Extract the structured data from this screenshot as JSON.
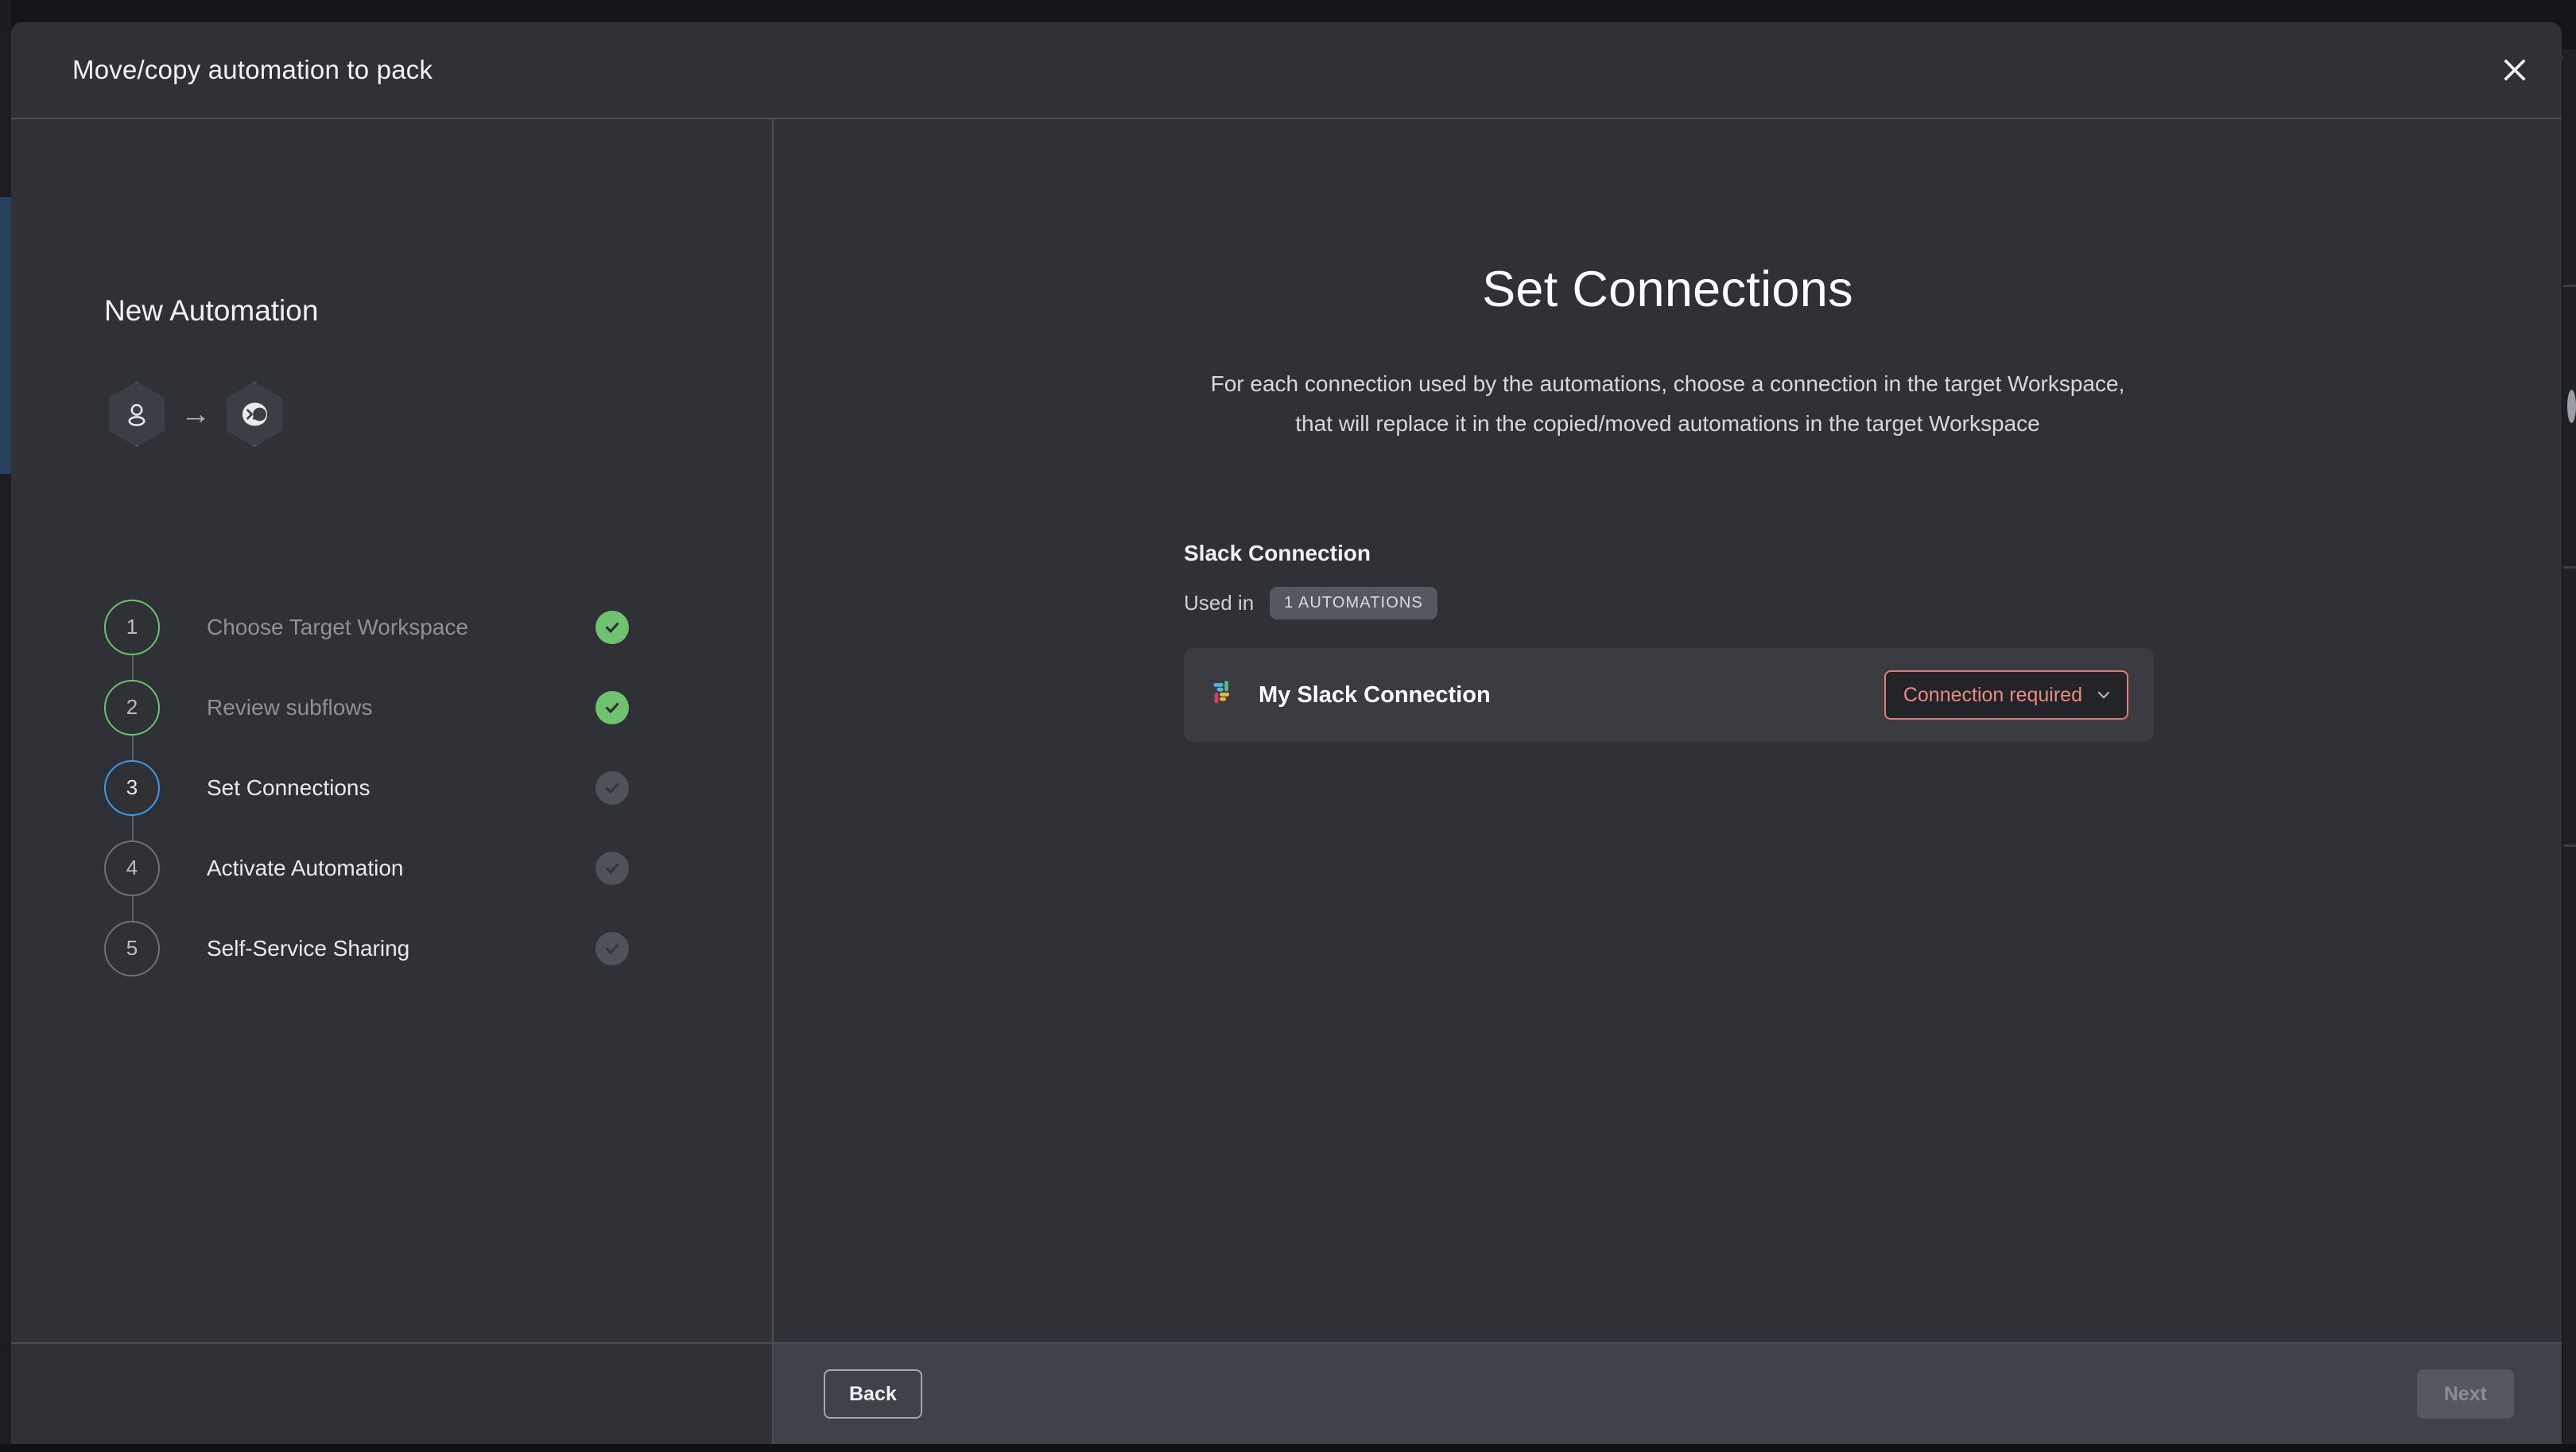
{
  "modal": {
    "title": "Move/copy automation to pack",
    "close_icon": "close-icon"
  },
  "sidebar": {
    "heading": "New Automation",
    "avatars": {
      "source_icon": "user-avatar-icon",
      "arrow": "→",
      "target_icon": "terminal-bot-icon"
    },
    "steps": [
      {
        "number": "1",
        "label": "Choose Target Workspace",
        "state": "done"
      },
      {
        "number": "2",
        "label": "Review subflows",
        "state": "done"
      },
      {
        "number": "3",
        "label": "Set Connections",
        "state": "active"
      },
      {
        "number": "4",
        "label": "Activate Automation",
        "state": "upcoming"
      },
      {
        "number": "5",
        "label": "Self-Service Sharing",
        "state": "upcoming"
      }
    ]
  },
  "main": {
    "title": "Set Connections",
    "description_line_1": "For each connection used by the automations, choose a connection in the target Workspace,",
    "description_line_2": "that will replace it in the copied/moved automations in the target Workspace",
    "connection_group": {
      "title": "Slack Connection",
      "usage_label": "Used in",
      "usage_badge": "1 AUTOMATIONS",
      "card": {
        "provider_icon": "slack-icon",
        "name": "My Slack Connection",
        "select_value": "Connection required",
        "select_chevron_icon": "chevron-down-icon"
      }
    }
  },
  "footer": {
    "back_label": "Back",
    "next_label": "Next"
  },
  "colors": {
    "modal_bg": "#2f3136",
    "footer_bg": "#3f4248",
    "card_bg": "#3a3c42",
    "step_done": "#70c271",
    "step_active": "#3d9ae8",
    "step_pending": "#4f5258",
    "error_border": "#e07b78",
    "error_text": "#e98a86",
    "badge_bg": "#55585e"
  }
}
